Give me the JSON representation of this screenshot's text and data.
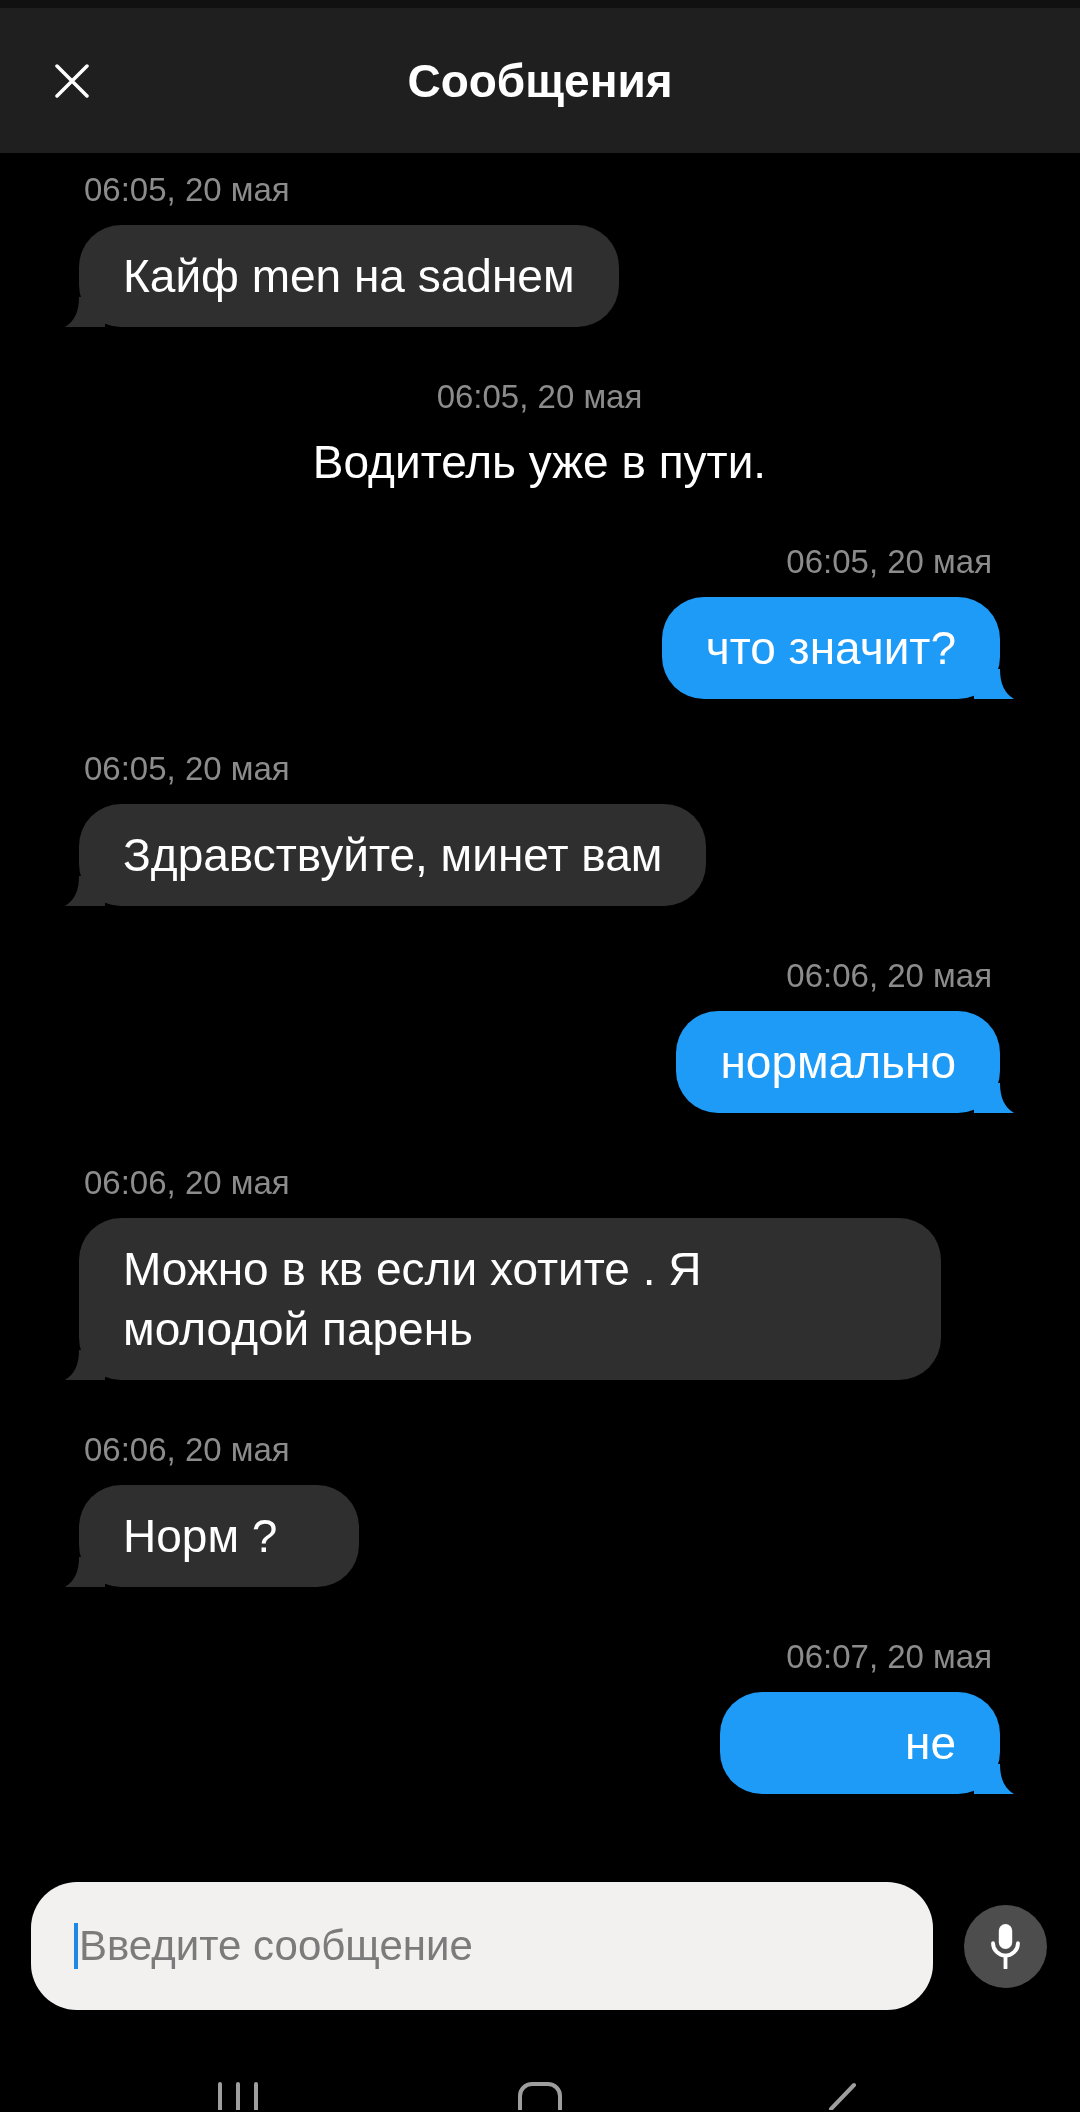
{
  "header": {
    "title": "Сообщения"
  },
  "messages": [
    {
      "kind": "incoming",
      "time": "06:05, 20 мая",
      "text": "Кайф men на sadнем"
    },
    {
      "kind": "system",
      "time": "06:05, 20 мая",
      "text": "Водитель уже в пути."
    },
    {
      "kind": "outgoing",
      "time": "06:05, 20 мая",
      "text": "что значит?"
    },
    {
      "kind": "incoming",
      "time": "06:05, 20 мая",
      "text": "Здравствуйте, минет вам"
    },
    {
      "kind": "outgoing",
      "time": "06:06, 20 мая",
      "text": "нормально"
    },
    {
      "kind": "incoming",
      "time": "06:06, 20 мая",
      "text": "Можно в кв если хотите . Я молодой парень"
    },
    {
      "kind": "incoming",
      "time": "06:06, 20 мая",
      "text": "Норм ?"
    },
    {
      "kind": "outgoing",
      "time": "06:07, 20 мая",
      "text": "не"
    }
  ],
  "composer": {
    "placeholder": "Введите сообщение",
    "focused": true
  }
}
